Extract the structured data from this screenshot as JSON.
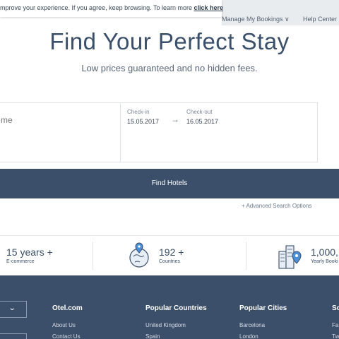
{
  "cookie_bar": {
    "text": "mprove your experience. If you agree, keep browsing. To learn more ",
    "link": "click here"
  },
  "nav": {
    "bookings": "Manage My Bookings ∨",
    "help": "Help Center"
  },
  "hero": {
    "title": "Find Your Perfect Stay",
    "subtitle": "Low prices guaranteed and no hidden fees."
  },
  "search": {
    "destination_placeholder": "me",
    "checkin_label": "Check-in",
    "checkin_value": "15.05.2017",
    "checkout_label": "Check-out",
    "checkout_value": "16.05.2017",
    "arrow": "→",
    "find_button": "Find Hotels",
    "advanced": "+ Advanced Search Options"
  },
  "stats": [
    {
      "value": "15 years +",
      "label": "E-commerce"
    },
    {
      "value": "192 +",
      "label": "Countries",
      "icon": "globe-pin-icon"
    },
    {
      "value": "1,000,",
      "label": "Yearly Booki",
      "icon": "city-pin-icon"
    }
  ],
  "footer": {
    "columns": [
      {
        "title": "Otel.com",
        "links": [
          "About Us",
          "Contact Us"
        ]
      },
      {
        "title": "Popular Countries",
        "links": [
          "United Kingdom",
          "Spain"
        ]
      },
      {
        "title": "Popular Cities",
        "links": [
          "Barcelona",
          "London"
        ]
      },
      {
        "title": "So",
        "links": [
          "Fa",
          "Tw"
        ]
      }
    ]
  },
  "colors": {
    "navy": "#3b4f6a",
    "nav_bg": "#e9ecef",
    "text": "#3a4f6a"
  }
}
